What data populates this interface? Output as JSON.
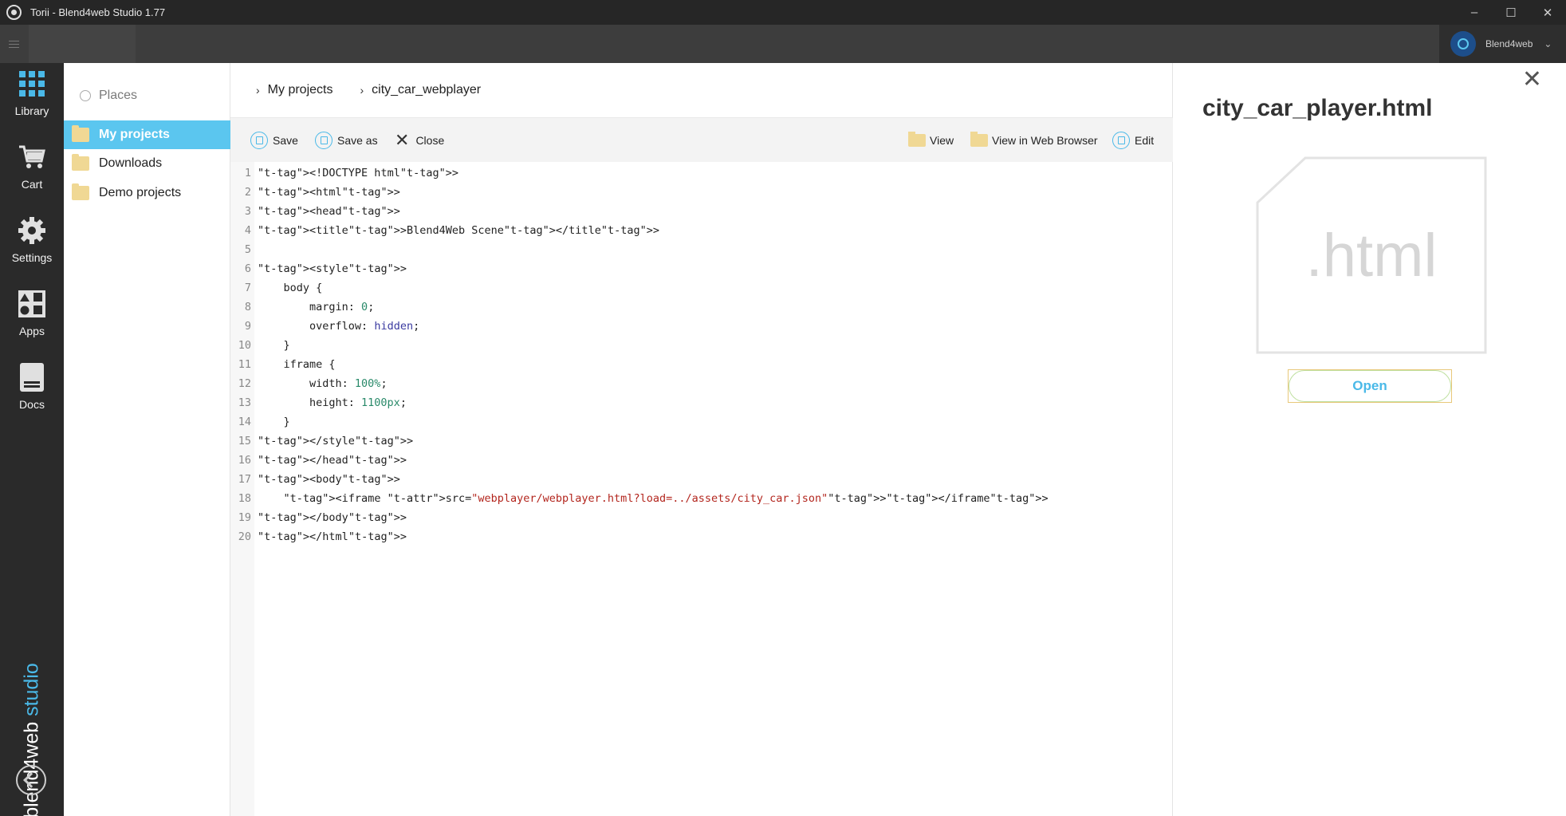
{
  "window": {
    "title": "Torii - Blend4web Studio 1.77",
    "controls": [
      "minimize",
      "maximize",
      "close"
    ]
  },
  "topbar": {
    "user_name": "Blend4web"
  },
  "rail": {
    "items": [
      {
        "label": "Library",
        "icon": "grid-icon"
      },
      {
        "label": "Cart",
        "icon": "cart-icon"
      },
      {
        "label": "Settings",
        "icon": "gear-icon"
      },
      {
        "label": "Apps",
        "icon": "apps-icon"
      },
      {
        "label": "Docs",
        "icon": "docs-icon"
      }
    ],
    "brand_main": "blend4web",
    "brand_suffix": " studio"
  },
  "places": {
    "header": "Places",
    "items": [
      {
        "label": "My projects",
        "active": true
      },
      {
        "label": "Downloads",
        "active": false
      },
      {
        "label": "Demo projects",
        "active": false
      }
    ]
  },
  "breadcrumb": [
    "My projects",
    "city_car_webplayer"
  ],
  "toolbar": {
    "save_label": "Save",
    "save_as_label": "Save as",
    "close_label": "Close",
    "view_label": "View",
    "view_browser_label": "View in Web Browser",
    "edit_label": "Edit"
  },
  "code": {
    "lines": [
      "<!DOCTYPE html>",
      "<html>",
      "<head>",
      "<title>Blend4Web Scene</title>",
      "",
      "<style>",
      "    body {",
      "        margin: 0;",
      "        overflow: hidden;",
      "    }",
      "    iframe {",
      "        width: 100%;",
      "        height: 1100px;",
      "    }",
      "</style>",
      "</head>",
      "<body>",
      "    <iframe src=\"webplayer/webplayer.html?load=../assets/city_car.json\"></iframe>",
      "</body>",
      "</html>"
    ]
  },
  "detail": {
    "file_name": "city_car_player.html",
    "extension": ".html",
    "open_label": "Open"
  },
  "colors": {
    "accent": "#4ab9e8",
    "rail_bg": "#2a2a2a",
    "folder": "#f0d894"
  }
}
